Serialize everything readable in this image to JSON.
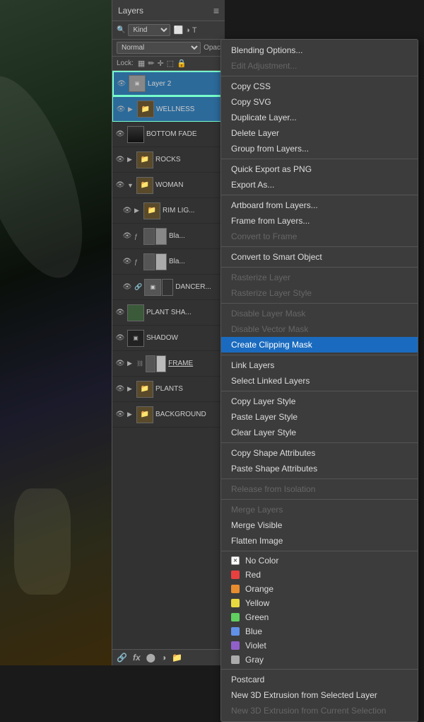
{
  "panel": {
    "title": "Layers",
    "menu_icon": "≡",
    "search": {
      "kind_label": "Kind",
      "kind_value": "Kind"
    },
    "blend": {
      "mode": "Normal",
      "opacity_label": "Opac"
    },
    "lock": {
      "label": "Lock:"
    }
  },
  "layers": [
    {
      "id": "layer2",
      "name": "Layer 2",
      "eye": true,
      "has_thumb": true,
      "selected": true,
      "indent": 0
    },
    {
      "id": "wellness",
      "name": "WELLNESS",
      "eye": true,
      "is_group": true,
      "selected": true,
      "indent": 0
    },
    {
      "id": "bottom-fade",
      "name": "BOTTOM FADE",
      "eye": true,
      "has_thumb": true,
      "indent": 0
    },
    {
      "id": "rocks",
      "name": "ROCKS",
      "eye": true,
      "is_group": true,
      "indent": 0
    },
    {
      "id": "woman",
      "name": "WOMAN",
      "eye": true,
      "is_group": true,
      "expanded": true,
      "indent": 0
    },
    {
      "id": "rim-lig",
      "name": "RIM LIG...",
      "eye": true,
      "is_group": true,
      "indent": 1
    },
    {
      "id": "bla1",
      "name": "Bla...",
      "eye": true,
      "has_mask": true,
      "has_fx": true,
      "indent": 1
    },
    {
      "id": "bla2",
      "name": "Bla...",
      "eye": true,
      "has_mask": true,
      "has_fx": true,
      "indent": 1
    },
    {
      "id": "dancer",
      "name": "DANCER...",
      "eye": true,
      "has_thumb": true,
      "has_mask": true,
      "indent": 1
    },
    {
      "id": "plant-sha",
      "name": "PLANT SHA...",
      "eye": true,
      "has_thumb": true,
      "indent": 0
    },
    {
      "id": "shadow",
      "name": "SHADOW",
      "eye": true,
      "has_thumb": true,
      "indent": 0
    },
    {
      "id": "frame",
      "name": "FRAME",
      "eye": true,
      "is_group": true,
      "has_mask": true,
      "underline": true,
      "indent": 0
    },
    {
      "id": "plants",
      "name": "PLANTS",
      "eye": true,
      "is_group": true,
      "indent": 0
    },
    {
      "id": "background",
      "name": "BACKGROUND",
      "eye": true,
      "is_group": true,
      "indent": 0
    }
  ],
  "footer": {
    "link_icon": "🔗",
    "fx_icon": "fx",
    "mask_icon": "⬤",
    "adj_icon": "◑",
    "folder_icon": "📁"
  },
  "context_menu": {
    "items": [
      {
        "label": "Blending Options...",
        "type": "normal"
      },
      {
        "label": "Edit Adjustment...",
        "type": "disabled"
      },
      {
        "type": "separator"
      },
      {
        "label": "Copy CSS",
        "type": "normal"
      },
      {
        "label": "Copy SVG",
        "type": "normal"
      },
      {
        "label": "Duplicate Layer...",
        "type": "normal"
      },
      {
        "label": "Delete Layer",
        "type": "normal"
      },
      {
        "label": "Group from Layers...",
        "type": "normal"
      },
      {
        "type": "separator"
      },
      {
        "label": "Quick Export as PNG",
        "type": "normal"
      },
      {
        "label": "Export As...",
        "type": "normal"
      },
      {
        "type": "separator"
      },
      {
        "label": "Artboard from Layers...",
        "type": "normal"
      },
      {
        "label": "Frame from Layers...",
        "type": "normal"
      },
      {
        "label": "Convert to Frame",
        "type": "disabled"
      },
      {
        "type": "separator"
      },
      {
        "label": "Convert to Smart Object",
        "type": "normal"
      },
      {
        "type": "separator"
      },
      {
        "label": "Rasterize Layer",
        "type": "disabled"
      },
      {
        "label": "Rasterize Layer Style",
        "type": "disabled"
      },
      {
        "type": "separator"
      },
      {
        "label": "Disable Layer Mask",
        "type": "disabled"
      },
      {
        "label": "Disable Vector Mask",
        "type": "disabled"
      },
      {
        "label": "Create Clipping Mask",
        "type": "highlighted"
      },
      {
        "type": "separator"
      },
      {
        "label": "Link Layers",
        "type": "normal"
      },
      {
        "label": "Select Linked Layers",
        "type": "normal"
      },
      {
        "type": "separator"
      },
      {
        "label": "Copy Layer Style",
        "type": "normal"
      },
      {
        "label": "Paste Layer Style",
        "type": "normal"
      },
      {
        "label": "Clear Layer Style",
        "type": "normal"
      },
      {
        "type": "separator"
      },
      {
        "label": "Copy Shape Attributes",
        "type": "normal"
      },
      {
        "label": "Paste Shape Attributes",
        "type": "normal"
      },
      {
        "type": "separator"
      },
      {
        "label": "Release from Isolation",
        "type": "disabled"
      },
      {
        "type": "separator"
      },
      {
        "label": "Merge Layers",
        "type": "disabled"
      },
      {
        "label": "Merge Visible",
        "type": "normal"
      },
      {
        "label": "Flatten Image",
        "type": "normal"
      },
      {
        "type": "separator"
      }
    ],
    "colors": [
      {
        "label": "No Color",
        "color": "none"
      },
      {
        "label": "Red",
        "color": "#e84040"
      },
      {
        "label": "Orange",
        "color": "#e88c30"
      },
      {
        "label": "Yellow",
        "color": "#e8d840"
      },
      {
        "label": "Green",
        "color": "#60d060"
      },
      {
        "label": "Blue",
        "color": "#6090e8"
      },
      {
        "label": "Violet",
        "color": "#9060c8"
      },
      {
        "label": "Gray",
        "color": "#aaaaaa"
      }
    ],
    "bottom_items": [
      {
        "label": "Postcard",
        "type": "normal"
      },
      {
        "label": "New 3D Extrusion from Selected Layer",
        "type": "normal"
      },
      {
        "label": "New 3D Extrusion from Current Selection",
        "type": "disabled"
      }
    ]
  }
}
